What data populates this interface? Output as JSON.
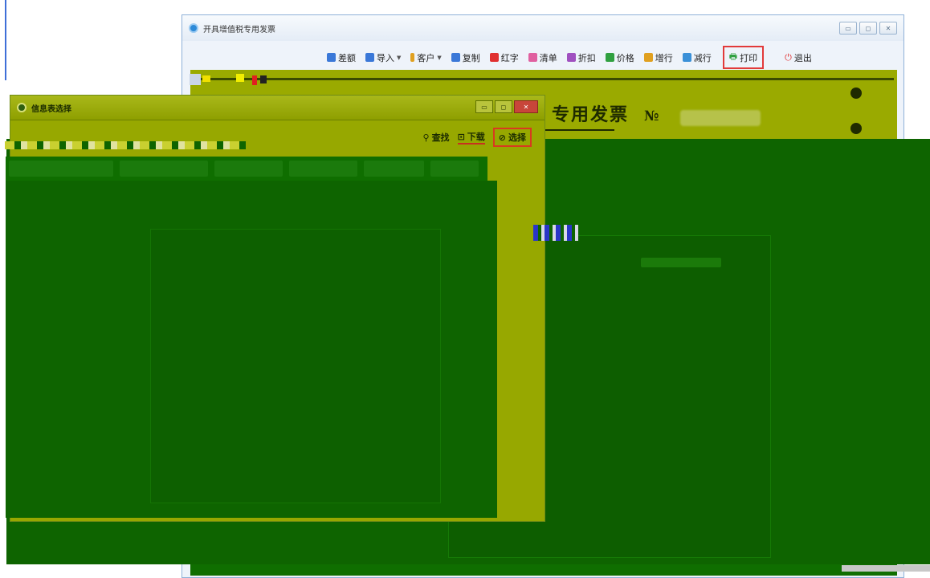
{
  "main_window": {
    "title": "开具增值税专用发票",
    "controls": [
      "▭",
      "◻",
      "✕"
    ]
  },
  "toolbar": {
    "items": [
      {
        "label": "差额",
        "icon": "difference-icon",
        "color": "#3a78d8"
      },
      {
        "label": "导入",
        "icon": "import-icon",
        "color": "#3a78d8",
        "dropdown": true
      },
      {
        "label": "客户",
        "icon": "customer-icon",
        "color": "#e0a020",
        "dropdown": true
      },
      {
        "label": "复制",
        "icon": "copy-icon",
        "color": "#3a78d8"
      },
      {
        "label": "红字",
        "icon": "red-invoice-icon",
        "color": "#e03030"
      },
      {
        "label": "清单",
        "icon": "list-icon",
        "color": "#e060a0"
      },
      {
        "label": "折扣",
        "icon": "discount-icon",
        "color": "#a050c0"
      },
      {
        "label": "价格",
        "icon": "price-icon",
        "color": "#30a040"
      },
      {
        "label": "增行",
        "icon": "add-row-icon",
        "color": "#e0a020"
      },
      {
        "label": "减行",
        "icon": "remove-row-icon",
        "color": "#3a90d8"
      }
    ],
    "print_label": "打印",
    "exit_label": "退出"
  },
  "invoice": {
    "title_fragment": "专用发票",
    "number_label": "№"
  },
  "dialog": {
    "title": "信息表选择",
    "controls": [
      "▭",
      "◻",
      "✕"
    ],
    "buttons": {
      "find_label": "查找",
      "download_label": "下载",
      "select_label": "选择"
    }
  },
  "colors": {
    "highlight_red": "#e23a3a",
    "olive": "#9aaa00",
    "dark_green": "#0e6400"
  }
}
